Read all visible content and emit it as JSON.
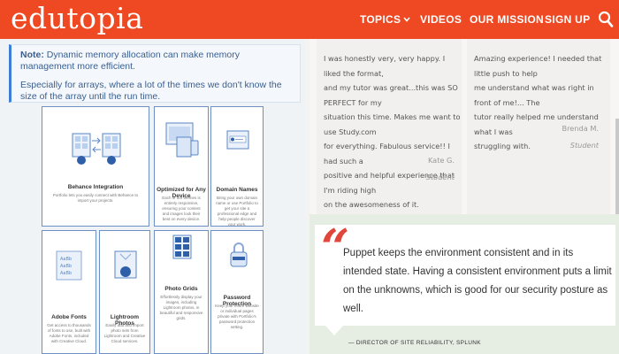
{
  "header": {
    "logo": "edutopia",
    "nav": {
      "topics": "TOPICS",
      "videos": "VIDEOS",
      "mission": "OUR MISSION",
      "signup": "SIGN UP"
    },
    "search_icon": "search-icon"
  },
  "note": {
    "label": "Note:",
    "text_1": " Dynamic memory allocation can make memory",
    "text_2": "management more efficient.",
    "text_3": "Especially for arrays, where a lot of the times we don't know the",
    "text_4": "size of the array until the run time."
  },
  "cards": [
    {
      "title": "Behance Integration",
      "desc": "Portfolio lets you easily connect with Behance to import your projects.",
      "icon": "behance-sync-icon"
    },
    {
      "title": "Optimized for Any Device",
      "desc": "Each of our themes is entirely responsive, ensuring your content and images look their best on every device.",
      "icon": "devices-icon"
    },
    {
      "title": "Domain Names",
      "desc": "Bring your own domain name or use Portfolio to get your site a professional edge and help people discover your work.",
      "icon": "domain-icon"
    },
    {
      "title": "Adobe Fonts",
      "desc": "Get access to thousands of fonts to use, built with Adobe Fonts, included with Creative Cloud.",
      "icon": "fonts-icon"
    },
    {
      "title": "Lightroom Photos",
      "desc": "Easily add and import photo sets from Lightroom and Creative Cloud services.",
      "icon": "lightroom-icon"
    },
    {
      "title": "Photo Grids",
      "desc": "Effortlessly display your images, including Lightroom photos, in beautiful and responsive grids.",
      "icon": "photo-grid-icon"
    },
    {
      "title": "Password Protection",
      "desc": "Keep your entire website or individual pages private with Portfolio's password protection setting.",
      "icon": "lock-icon"
    }
  ],
  "reviews": [
    {
      "lines": [
        "I was honestly very, very happy. I liked the format,",
        "and my tutor was great...this was SO PERFECT for my",
        "situation this time. Makes me want to use Study.com",
        "for everything. Fabulous service!! I had such a",
        "positive and helpful experience that I'm riding high",
        "on the awesomeness of it."
      ],
      "name": "Kate G.",
      "role": "Student"
    },
    {
      "lines": [
        "Amazing experience! I needed that little push to help",
        "me understand what was right in front of me!... The",
        "tutor really helped me understand what I was",
        "struggling with."
      ],
      "name": "Brenda M.",
      "role": "Student"
    }
  ],
  "quote": {
    "mark": "“",
    "text": "Puppet keeps the environment consistent and in its intended state. Having a consistent environment puts a limit on the unknowns, which is good for our security posture as well.",
    "attribution": "— DIRECTOR OF SITE RELIABILITY, SPLUNK"
  },
  "colors": {
    "brand_orange": "#ef4923",
    "note_accent": "#3d7fd6",
    "card_border": "#6e8fc4",
    "quote_mark": "#e0463a",
    "quote_bg": "#e6eee4"
  }
}
